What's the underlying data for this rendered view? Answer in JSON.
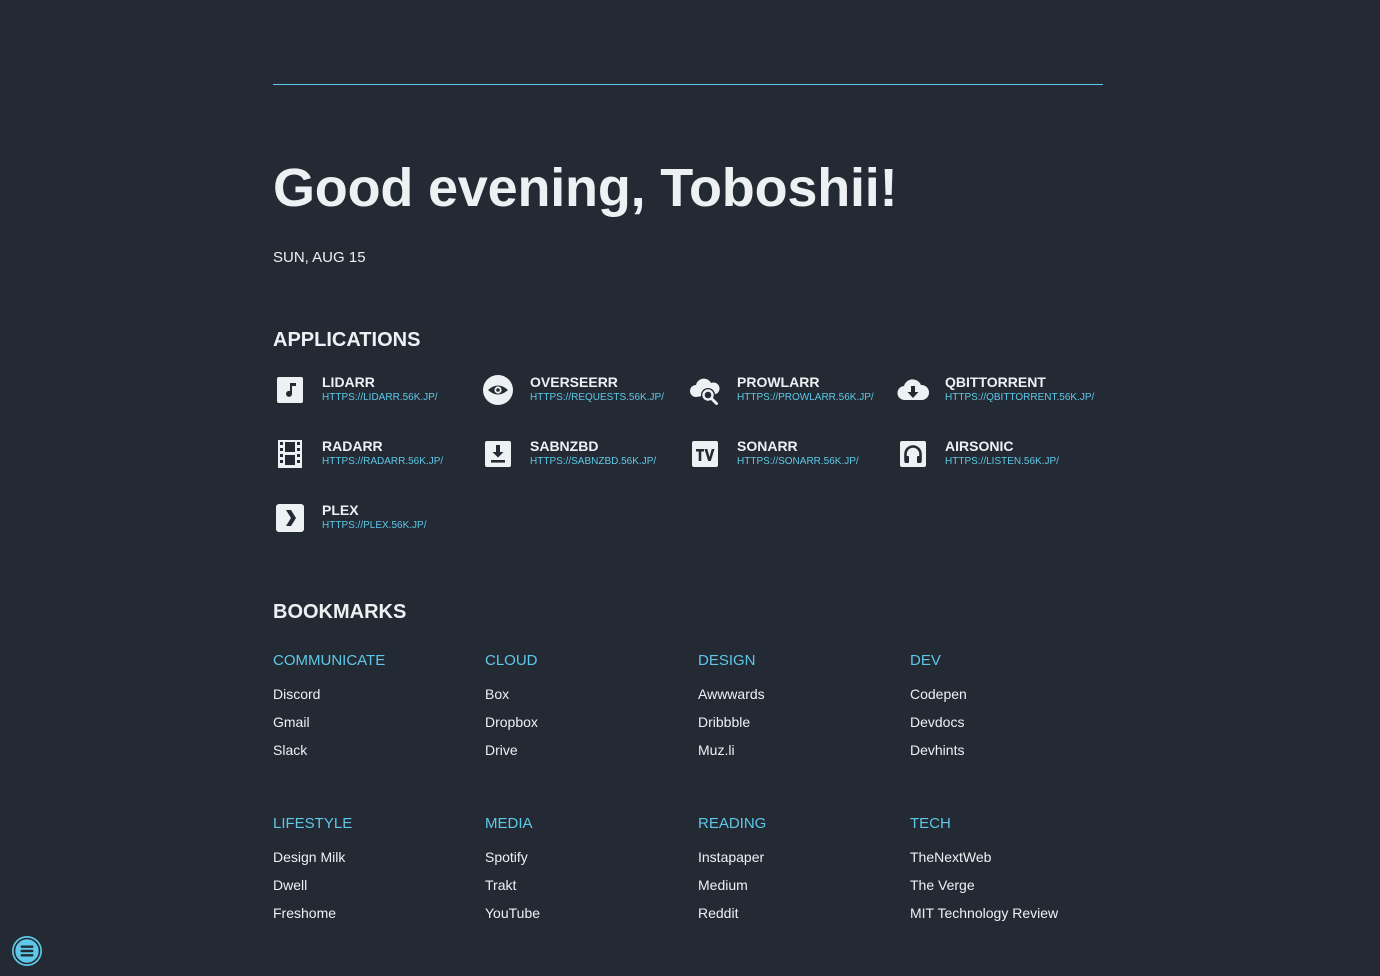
{
  "greeting": "Good evening, Toboshii!",
  "date": "SUN, AUG 15",
  "applications": {
    "title": "APPLICATIONS",
    "items": [
      {
        "name": "LIDARR",
        "url": "HTTPS://LIDARR.56K.JP/",
        "icon": "music-note-icon"
      },
      {
        "name": "OVERSEERR",
        "url": "HTTPS://REQUESTS.56K.JP/",
        "icon": "eye-icon"
      },
      {
        "name": "PROWLARR",
        "url": "HTTPS://PROWLARR.56K.JP/",
        "icon": "cloud-search-icon"
      },
      {
        "name": "QBITTORRENT",
        "url": "HTTPS://QBITTORRENT.56K.JP/",
        "icon": "cloud-download-icon"
      },
      {
        "name": "RADARR",
        "url": "HTTPS://RADARR.56K.JP/",
        "icon": "film-icon"
      },
      {
        "name": "SABNZBD",
        "url": "HTTPS://SABNZBD.56K.JP/",
        "icon": "download-box-icon"
      },
      {
        "name": "SONARR",
        "url": "HTTPS://SONARR.56K.JP/",
        "icon": "tv-icon"
      },
      {
        "name": "AIRSONIC",
        "url": "HTTPS://LISTEN.56K.JP/",
        "icon": "headphones-icon"
      },
      {
        "name": "PLEX",
        "url": "HTTPS://PLEX.56K.JP/",
        "icon": "plex-icon"
      }
    ]
  },
  "bookmarks": {
    "title": "BOOKMARKS",
    "groups": [
      {
        "category": "COMMUNICATE",
        "links": [
          "Discord",
          "Gmail",
          "Slack"
        ]
      },
      {
        "category": "CLOUD",
        "links": [
          "Box",
          "Dropbox",
          "Drive"
        ]
      },
      {
        "category": "DESIGN",
        "links": [
          "Awwwards",
          "Dribbble",
          "Muz.li"
        ]
      },
      {
        "category": "DEV",
        "links": [
          "Codepen",
          "Devdocs",
          "Devhints"
        ]
      },
      {
        "category": "LIFESTYLE",
        "links": [
          "Design Milk",
          "Dwell",
          "Freshome"
        ]
      },
      {
        "category": "MEDIA",
        "links": [
          "Spotify",
          "Trakt",
          "YouTube"
        ]
      },
      {
        "category": "READING",
        "links": [
          "Instapaper",
          "Medium",
          "Reddit"
        ]
      },
      {
        "category": "TECH",
        "links": [
          "TheNextWeb",
          "The Verge",
          "MIT Technology Review"
        ]
      }
    ]
  },
  "menu_button": {
    "icon": "menu-icon"
  },
  "colors": {
    "background": "#232a33",
    "accent": "#5ec8e8",
    "text": "#eef1f4"
  }
}
